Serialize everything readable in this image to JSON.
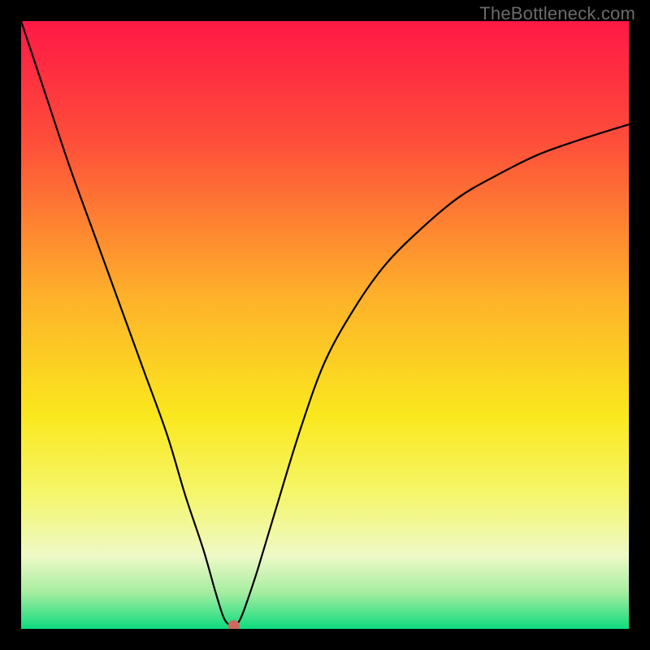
{
  "watermark": "TheBottleneck.com",
  "chart_data": {
    "type": "line",
    "title": "",
    "xlabel": "",
    "ylabel": "",
    "xlim": [
      0,
      100
    ],
    "ylim": [
      0,
      100
    ],
    "background_gradient": {
      "stops": [
        {
          "offset": 0,
          "color": "#ff1846"
        },
        {
          "offset": 20,
          "color": "#fe4f3a"
        },
        {
          "offset": 45,
          "color": "#feb02a"
        },
        {
          "offset": 65,
          "color": "#fae81e"
        },
        {
          "offset": 78,
          "color": "#f5f66c"
        },
        {
          "offset": 88,
          "color": "#eef9c7"
        },
        {
          "offset": 94,
          "color": "#a7eda0"
        },
        {
          "offset": 100,
          "color": "#0ddb7e"
        }
      ]
    },
    "series": [
      {
        "name": "bottleneck-curve",
        "color": "#000000",
        "stroke_width": 2.2,
        "x": [
          0,
          4,
          8,
          12,
          16,
          20,
          24,
          27,
          30,
          32,
          33.5,
          35,
          36,
          37,
          39,
          42,
          46,
          50,
          55,
          60,
          66,
          72,
          78,
          85,
          92,
          100
        ],
        "y": [
          100,
          88,
          76,
          65,
          54,
          43,
          32,
          22,
          13,
          6,
          1.5,
          0.5,
          1.5,
          4,
          10,
          20,
          33,
          44,
          53,
          60,
          66,
          71,
          74.5,
          78,
          80.5,
          83
        ]
      }
    ],
    "markers": [
      {
        "name": "min-point",
        "x": 35,
        "y": 0.5,
        "color": "#cc6a5f",
        "radius": 7
      }
    ]
  }
}
